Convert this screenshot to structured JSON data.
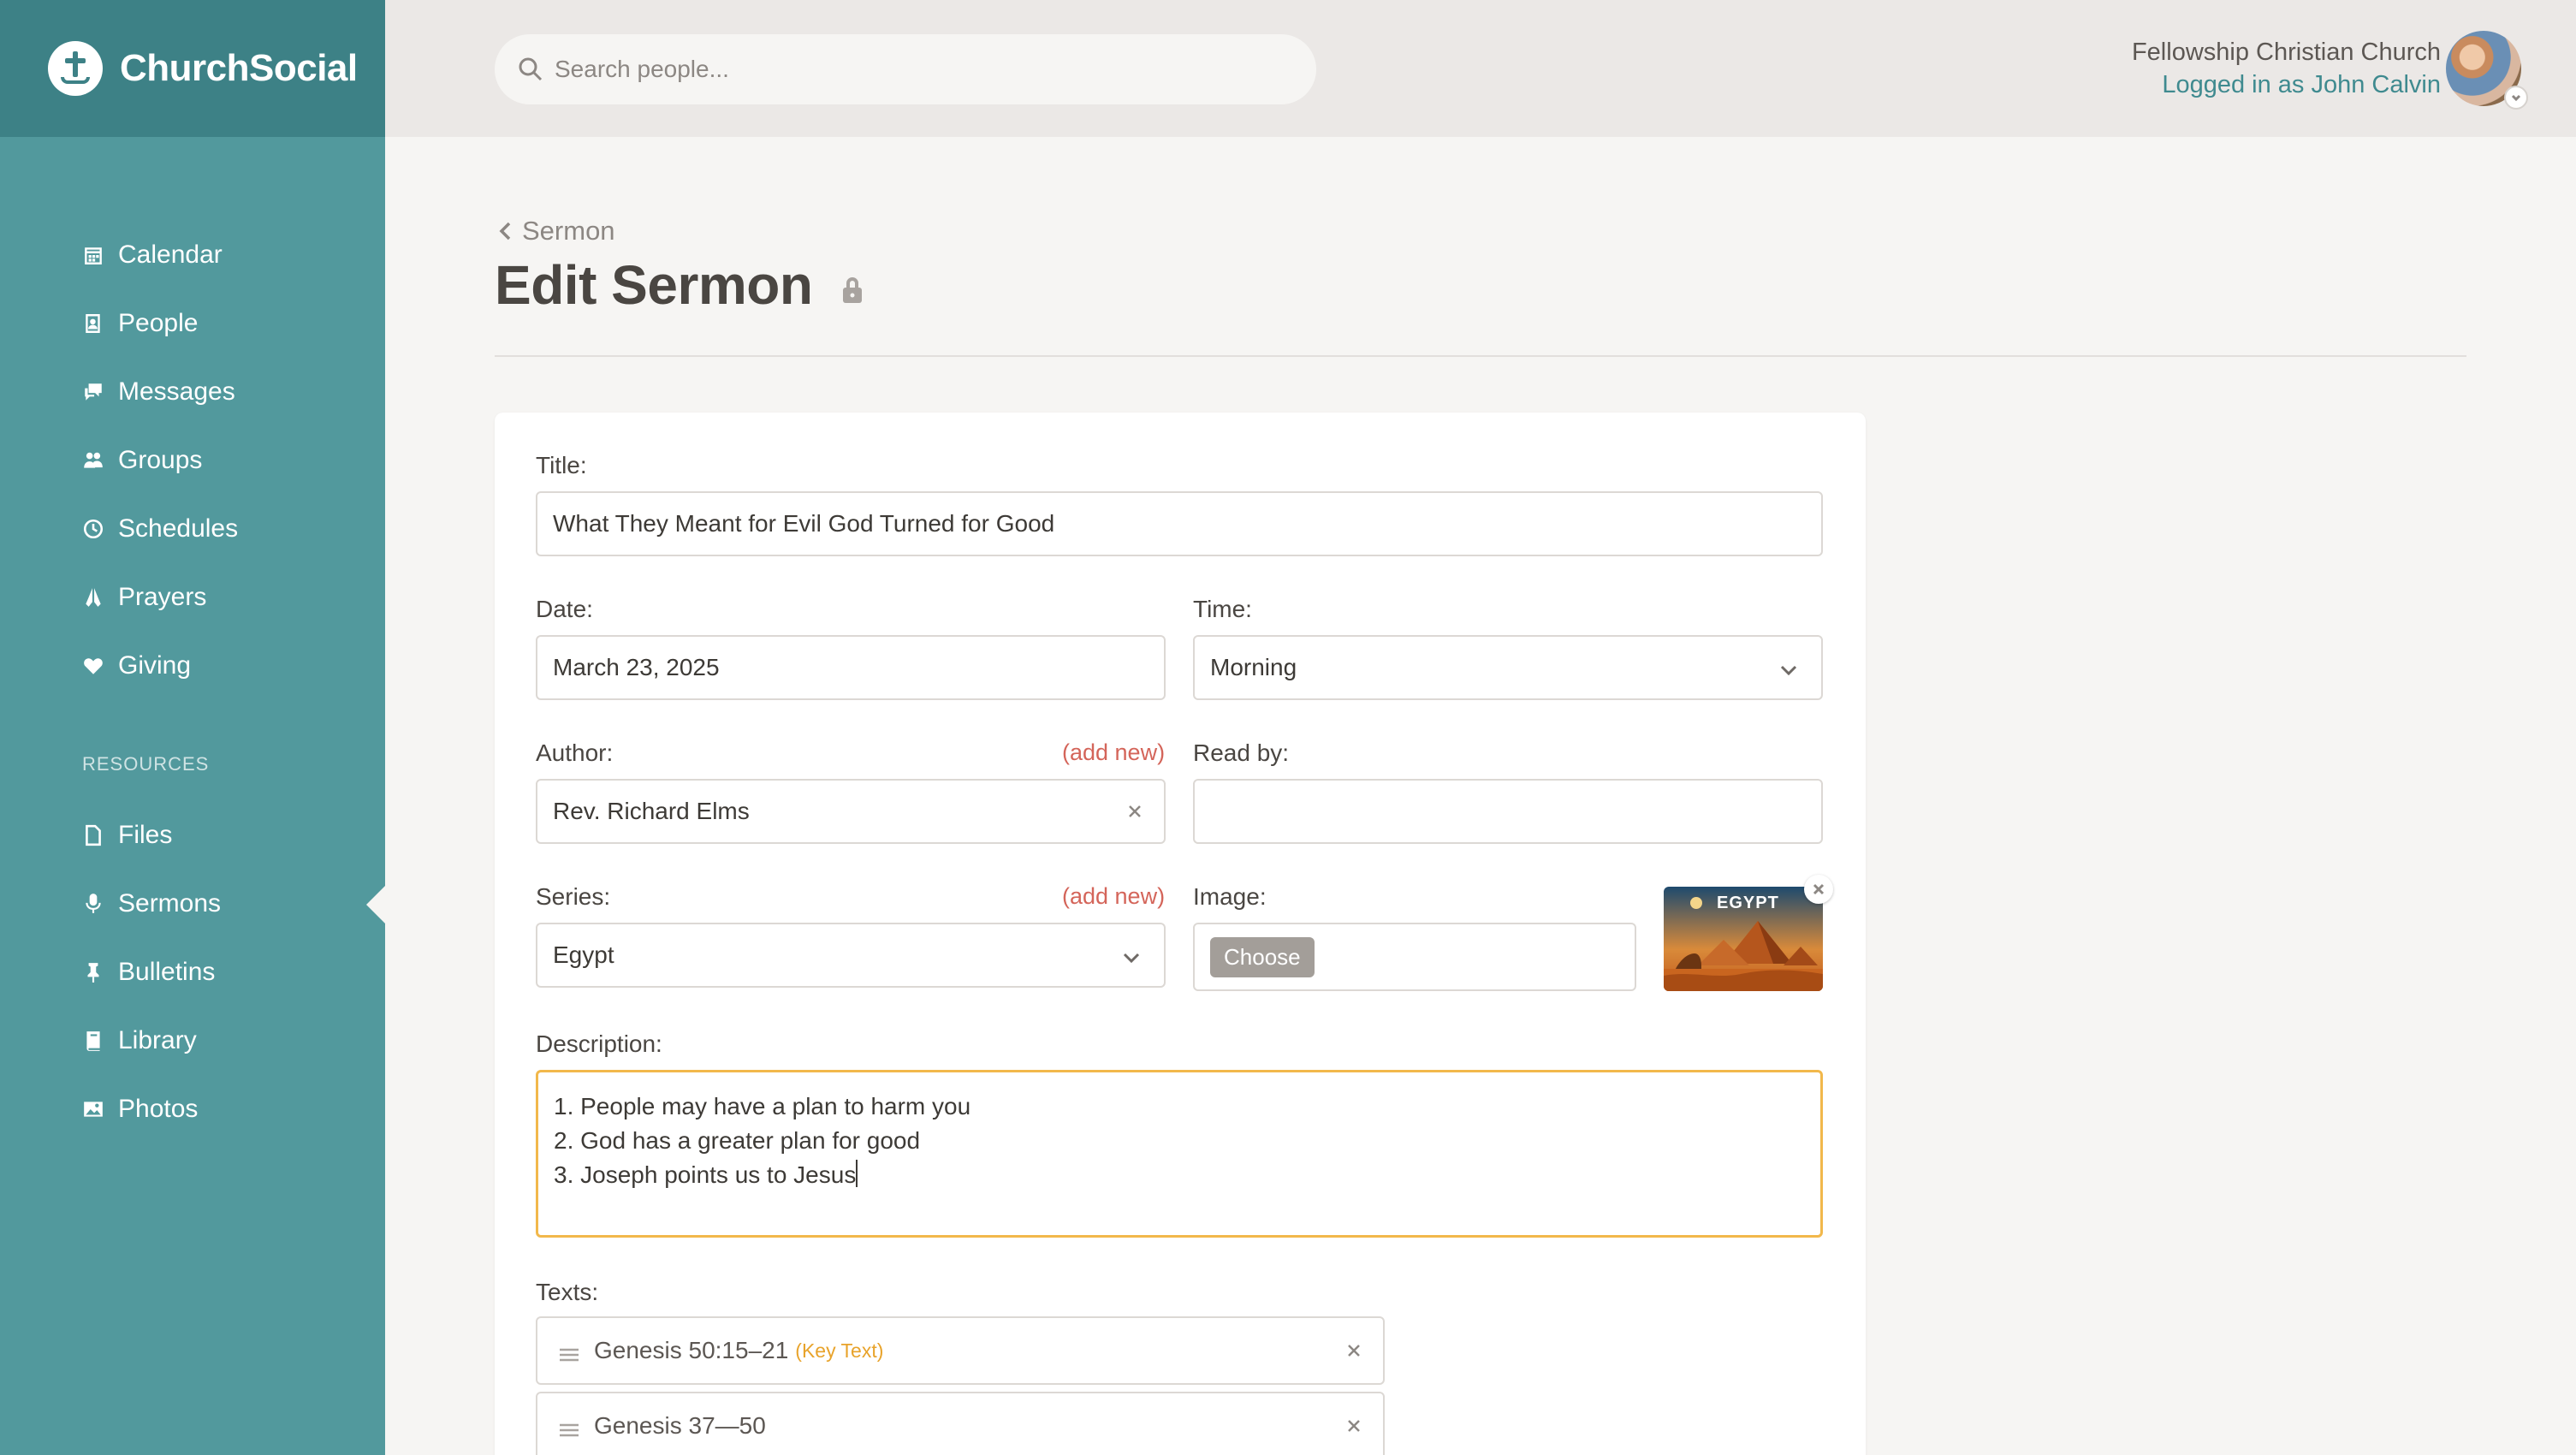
{
  "brand": {
    "name": "ChurchSocial"
  },
  "sidebar": {
    "items": [
      {
        "label": "Calendar",
        "icon": "calendar-icon"
      },
      {
        "label": "People",
        "icon": "people-icon"
      },
      {
        "label": "Messages",
        "icon": "messages-icon"
      },
      {
        "label": "Groups",
        "icon": "groups-icon"
      },
      {
        "label": "Schedules",
        "icon": "clock-icon"
      },
      {
        "label": "Prayers",
        "icon": "praying-hands-icon"
      },
      {
        "label": "Giving",
        "icon": "heart-icon"
      }
    ],
    "resources_heading": "RESOURCES",
    "resources": [
      {
        "label": "Files",
        "icon": "file-icon"
      },
      {
        "label": "Sermons",
        "icon": "microphone-icon",
        "active": true
      },
      {
        "label": "Bulletins",
        "icon": "pin-icon"
      },
      {
        "label": "Library",
        "icon": "book-icon"
      },
      {
        "label": "Photos",
        "icon": "image-icon"
      }
    ]
  },
  "header": {
    "search_placeholder": "Search people...",
    "church_name": "Fellowship Christian Church",
    "logged_in": "Logged in as John Calvin"
  },
  "page": {
    "breadcrumb": "Sermon",
    "title": "Edit Sermon"
  },
  "form": {
    "title_label": "Title:",
    "title_value": "What They Meant for Evil God Turned for Good",
    "date_label": "Date:",
    "date_value": "March 23, 2025",
    "time_label": "Time:",
    "time_value": "Morning",
    "author_label": "Author:",
    "author_add": "(add new)",
    "author_value": "Rev. Richard Elms",
    "readby_label": "Read by:",
    "readby_value": "",
    "series_label": "Series:",
    "series_add": "(add new)",
    "series_value": "Egypt",
    "image_label": "Image:",
    "choose_label": "Choose",
    "image_thumb_text": "EGYPT",
    "description_label": "Description:",
    "description_lines": [
      "1. People may have a plan to harm you",
      "2. God has a greater plan for good",
      "3. Joseph points us to Jesus"
    ],
    "texts_label": "Texts:",
    "texts": [
      {
        "ref": "Genesis 50:15–21",
        "tag": "(Key Text)"
      },
      {
        "ref": "Genesis 37—50",
        "tag": ""
      }
    ]
  },
  "colors": {
    "sidebar": "#52999d",
    "brand_bar": "#3d8186",
    "accent_link": "#3f8a8f",
    "add_new": "#d4655a",
    "focus_border": "#f2b84b",
    "key_text": "#e8a32b"
  }
}
